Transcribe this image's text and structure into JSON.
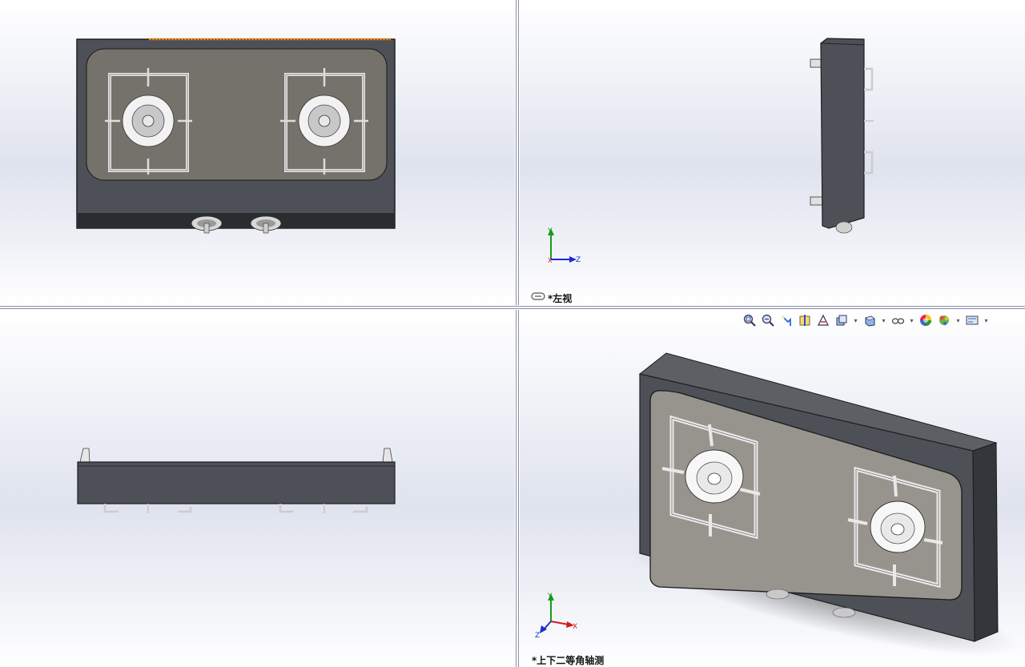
{
  "views": {
    "top_left": {
      "name": "front-view"
    },
    "top_right": {
      "name": "left-view",
      "label": "*左视"
    },
    "bottom_left": {
      "name": "top-view"
    },
    "bottom_right": {
      "name": "trimetric-view",
      "label": "*上下二等角轴测"
    }
  },
  "triad": {
    "x": "X",
    "y": "Y",
    "z": "Z"
  },
  "colors": {
    "body": "#4d5056",
    "top_plate": "#75726b",
    "grate": "#dcdcdc",
    "axis_x": "#d41c1c",
    "axis_y": "#1a9a1a",
    "axis_z": "#1c2bd4",
    "selection_edge": "#e88a1a"
  },
  "toolbar": [
    {
      "name": "zoom-to-fit-icon"
    },
    {
      "name": "zoom-to-area-icon"
    },
    {
      "name": "previous-view-icon"
    },
    {
      "name": "section-view-icon"
    },
    {
      "name": "dynamic-annotation-icon"
    },
    {
      "name": "view-orientation-icon",
      "dropdown": true
    },
    {
      "name": "display-style-icon",
      "dropdown": true
    },
    {
      "name": "hide-show-items-icon",
      "dropdown": true
    },
    {
      "name": "edit-appearance-icon"
    },
    {
      "name": "apply-scene-icon",
      "dropdown": true
    },
    {
      "name": "view-settings-icon",
      "dropdown": true
    }
  ]
}
